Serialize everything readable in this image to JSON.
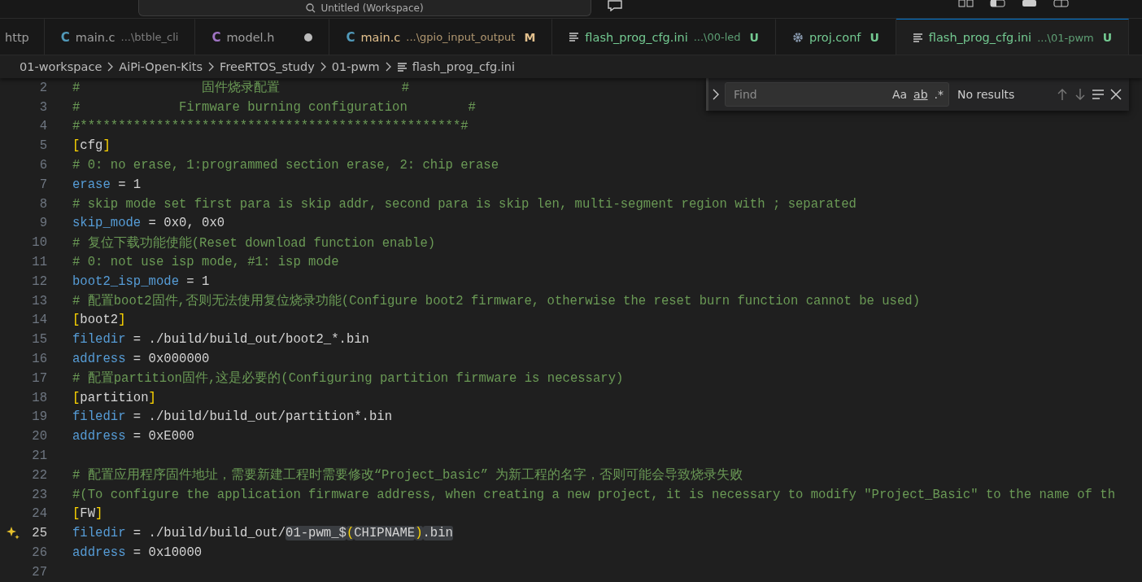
{
  "title_bar": {
    "search_text": "Untitled (Workspace)"
  },
  "tabs": [
    {
      "kind": "partial",
      "name": "http",
      "selected": false
    },
    {
      "kind": "c",
      "glyph": "C",
      "name": "main.c",
      "path": "...\\btble_cli",
      "selected": false
    },
    {
      "kind": "h",
      "glyph": "C",
      "name": "model.h",
      "dirty": true,
      "selected": false
    },
    {
      "kind": "c",
      "glyph": "C",
      "name": "main.c",
      "path": "...\\gpio_input_output",
      "color": "#e2c08d",
      "badge": "M",
      "selected": false
    },
    {
      "kind": "ini",
      "name": "flash_prog_cfg.ini",
      "path": "...\\00-led",
      "color": "#73c991",
      "badge": "U",
      "selected": false
    },
    {
      "kind": "conf",
      "name": "proj.conf",
      "color": "#73c991",
      "badge": "U",
      "selected": false
    },
    {
      "kind": "ini",
      "name": "flash_prog_cfg.ini",
      "path": "...\\01-pwm",
      "color": "#73c991",
      "badge": "U",
      "selected": true
    }
  ],
  "breadcrumbs": [
    "01-workspace",
    "AiPi-Open-Kits",
    "FreeRTOS_study",
    "01-pwm",
    "flash_prog_cfg.ini"
  ],
  "editor": {
    "lines": [
      {
        "number": "2",
        "tokens": [
          {
            "kind": "comment",
            "text": "#                固件烧录配置                #"
          }
        ]
      },
      {
        "number": "3",
        "tokens": [
          {
            "kind": "comment",
            "text": "#             Firmware burning configuration        #"
          }
        ]
      },
      {
        "number": "4",
        "tokens": [
          {
            "kind": "comment",
            "text": "#**************************************************#"
          }
        ]
      },
      {
        "number": "5",
        "tokens": [
          {
            "kind": "bracket",
            "text": "["
          },
          {
            "kind": "plain",
            "text": "cfg"
          },
          {
            "kind": "bracket",
            "text": "]"
          }
        ]
      },
      {
        "number": "6",
        "tokens": [
          {
            "kind": "comment",
            "text": "# 0: no erase, 1:programmed section erase, 2: chip erase"
          }
        ]
      },
      {
        "number": "7",
        "tokens": [
          {
            "kind": "key",
            "text": "erase"
          },
          {
            "kind": "plain",
            "text": " = 1"
          }
        ]
      },
      {
        "number": "8",
        "tokens": [
          {
            "kind": "comment",
            "text": "# skip mode set first para is skip addr, second para is skip len, multi-segment region with ; separated"
          }
        ]
      },
      {
        "number": "9",
        "tokens": [
          {
            "kind": "key",
            "text": "skip_mode"
          },
          {
            "kind": "plain",
            "text": " = 0x0, 0x0"
          }
        ]
      },
      {
        "number": "10",
        "tokens": [
          {
            "kind": "comment",
            "text": "# 复位下载功能使能(Reset download function enable)"
          }
        ]
      },
      {
        "number": "11",
        "tokens": [
          {
            "kind": "comment",
            "text": "# 0: not use isp mode, #1: isp mode"
          }
        ]
      },
      {
        "number": "12",
        "tokens": [
          {
            "kind": "key",
            "text": "boot2_isp_mode"
          },
          {
            "kind": "plain",
            "text": " = 1"
          }
        ]
      },
      {
        "number": "13",
        "tokens": [
          {
            "kind": "comment",
            "text": "# 配置boot2固件,否则无法使用复位烧录功能(Configure boot2 firmware, otherwise the reset burn function cannot be used)"
          }
        ]
      },
      {
        "number": "14",
        "tokens": [
          {
            "kind": "bracket",
            "text": "["
          },
          {
            "kind": "plain",
            "text": "boot2"
          },
          {
            "kind": "bracket",
            "text": "]"
          }
        ]
      },
      {
        "number": "15",
        "tokens": [
          {
            "kind": "key",
            "text": "filedir"
          },
          {
            "kind": "plain",
            "text": " = ./build/build_out/boot2_*.bin"
          }
        ]
      },
      {
        "number": "16",
        "tokens": [
          {
            "kind": "key",
            "text": "address"
          },
          {
            "kind": "plain",
            "text": " = 0x000000"
          }
        ]
      },
      {
        "number": "17",
        "tokens": [
          {
            "kind": "comment",
            "text": "# 配置partition固件,这是必要的(Configuring partition firmware is necessary)"
          }
        ]
      },
      {
        "number": "18",
        "tokens": [
          {
            "kind": "bracket",
            "text": "["
          },
          {
            "kind": "plain",
            "text": "partition"
          },
          {
            "kind": "bracket",
            "text": "]"
          }
        ]
      },
      {
        "number": "19",
        "tokens": [
          {
            "kind": "key",
            "text": "filedir"
          },
          {
            "kind": "plain",
            "text": " = ./build/build_out/partition*.bin"
          }
        ]
      },
      {
        "number": "20",
        "tokens": [
          {
            "kind": "key",
            "text": "address"
          },
          {
            "kind": "plain",
            "text": " = 0xE000"
          }
        ]
      },
      {
        "number": "21"
      },
      {
        "number": "22",
        "tokens": [
          {
            "kind": "comment",
            "text": "# 配置应用程序固件地址，需要新建工程时需要修改“Project_basic” 为新工程的名字，否则可能会导致烧录失败"
          }
        ]
      },
      {
        "number": "23",
        "tokens": [
          {
            "kind": "comment",
            "text": "#(To configure the application firmware address, when creating a new project, it is necessary to modify \"Project_Basic\" to the name of th"
          }
        ]
      },
      {
        "number": "24",
        "tokens": [
          {
            "kind": "bracket",
            "text": "["
          },
          {
            "kind": "plain",
            "text": "FW"
          },
          {
            "kind": "bracket",
            "text": "]"
          }
        ]
      },
      {
        "number": "25",
        "current": true,
        "sparkle": true,
        "tokens": [
          {
            "kind": "key",
            "text": "filedir"
          },
          {
            "kind": "plain",
            "text": " = ./build/build_out/"
          },
          {
            "kind": "plain",
            "text": "01-pwm_$",
            "highlighted": true
          },
          {
            "kind": "bracket",
            "text": "(",
            "highlighted": true
          },
          {
            "kind": "plain",
            "text": "CHIPNAME",
            "highlighted": true
          },
          {
            "kind": "bracket",
            "text": ")",
            "highlighted": true
          },
          {
            "kind": "plain",
            "text": ".bin",
            "highlighted": true
          }
        ]
      },
      {
        "number": "26",
        "tokens": [
          {
            "kind": "key",
            "text": "address"
          },
          {
            "kind": "plain",
            "text": " = 0x10000"
          }
        ]
      },
      {
        "number": "27"
      }
    ]
  },
  "find": {
    "placeholder": "Find",
    "options": [
      "Aa",
      "ab",
      ".*"
    ],
    "result": "No results"
  }
}
